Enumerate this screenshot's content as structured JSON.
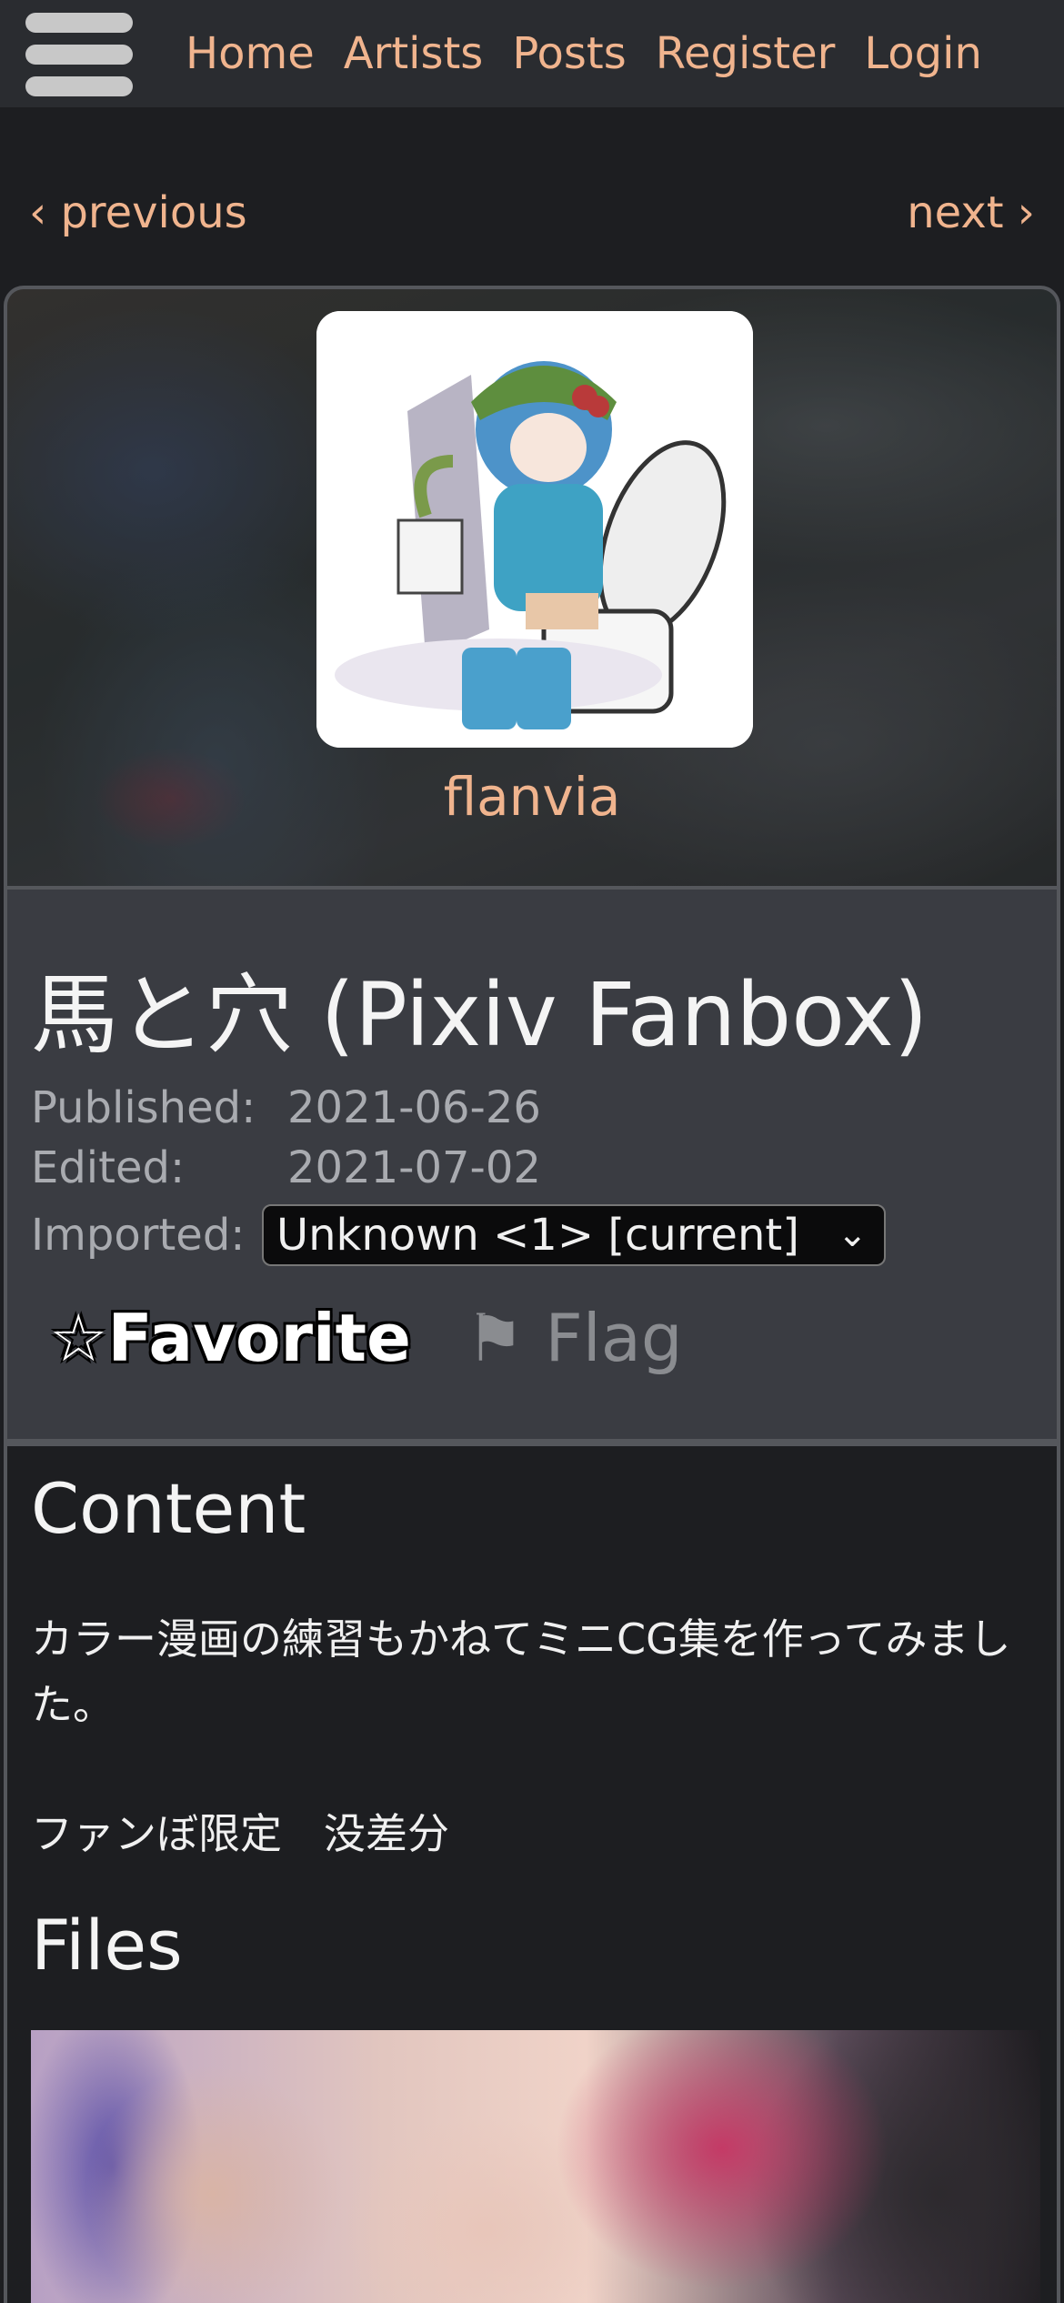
{
  "nav": {
    "links": [
      "Home",
      "Artists",
      "Posts",
      "Register",
      "Login"
    ]
  },
  "pager": {
    "previous": "‹ previous",
    "next": "next ›"
  },
  "artist": {
    "name": "flanvia"
  },
  "post": {
    "title": "馬と穴 (Pixiv Fanbox)",
    "published_label": "Published:",
    "published": "2021-06-26",
    "edited_label": "Edited:",
    "edited": "2021-07-02",
    "imported_label": "Imported:",
    "imported_value": "Unknown <1> [current]",
    "favorite": "☆Favorite",
    "flag": "⚑ Flag"
  },
  "content": {
    "heading": "Content",
    "paragraph1": "カラー漫画の練習もかねてミニCG集を作ってみました。",
    "paragraph2": "ファンぼ限定　没差分",
    "files_heading": "Files"
  },
  "colors": {
    "link": "#f0b48e",
    "nav_bg": "#2a2c30",
    "page_bg": "#1d1e21",
    "info_bg": "#3a3c42"
  }
}
